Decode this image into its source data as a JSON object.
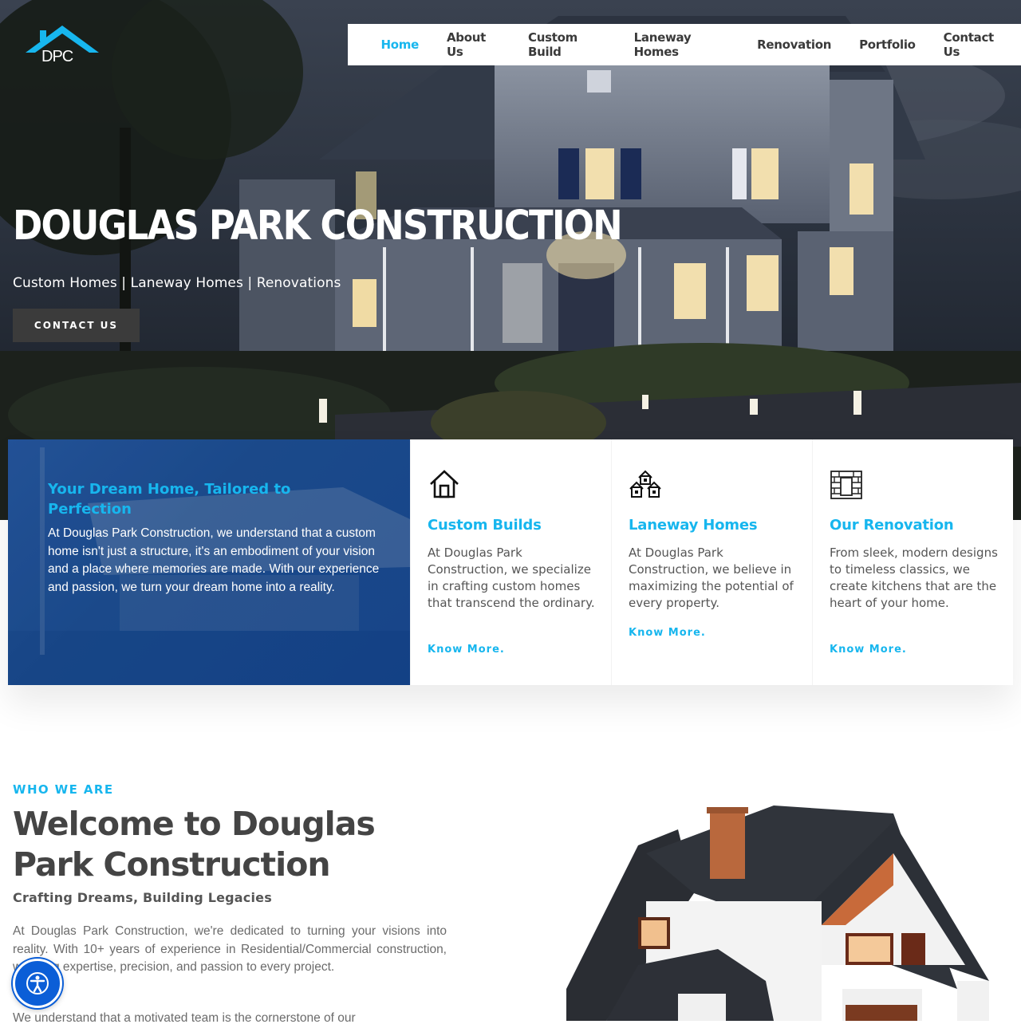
{
  "brand": {
    "logo_text": "DPC",
    "accent": "#17b6ee",
    "nav_bg": "#ffffff",
    "button_bg": "#3b3b3b",
    "card_blue": "#0d3a7e"
  },
  "nav": {
    "items": [
      {
        "label": "Home",
        "active": true
      },
      {
        "label": "About Us"
      },
      {
        "label": "Custom Build"
      },
      {
        "label": "Laneway Homes"
      },
      {
        "label": "Renovation"
      },
      {
        "label": "Portfolio"
      },
      {
        "label": "Contact Us"
      }
    ]
  },
  "hero": {
    "title": "DOUGLAS PARK CONSTRUCTION",
    "subtitle": "Custom Homes | Laneway Homes | Renovations",
    "cta": "CONTACT US"
  },
  "intro_card": {
    "title": "Your Dream Home, Tailored to Perfection",
    "body": "At Douglas Park Construction, we understand that a custom home isn't just a structure, it's an embodiment of your vision and a place where memories are made. With our experience and passion, we turn your dream home into a reality."
  },
  "services": [
    {
      "icon": "house-outline-icon",
      "title": "Custom Builds",
      "body": "At Douglas Park Construction, we specialize in crafting custom homes that transcend the ordinary.",
      "link": "Know More."
    },
    {
      "icon": "houses-group-icon",
      "title": "Laneway Homes",
      "body": "At Douglas Park Construction, we believe in maximizing the potential of every property.",
      "link": "Know More."
    },
    {
      "icon": "brick-wall-icon",
      "title": "Our Renovation",
      "body": "From sleek, modern designs to timeless classics, we create kitchens that are the heart of your home.",
      "link": "Know More."
    }
  ],
  "about": {
    "eyebrow": "WHO WE ARE",
    "heading": "Welcome to Douglas Park Construction",
    "tagline": "Crafting Dreams, Building Legacies",
    "para1": "At Douglas Park Construction, we're dedicated to turning your visions into reality. With 10+ years of experience in Residential/Commercial construction, we bring expertise, precision, and passion to every project.",
    "para2": "We understand that a motivated team is the cornerstone of our"
  },
  "accessibility": {
    "icon": "accessibility-icon"
  }
}
